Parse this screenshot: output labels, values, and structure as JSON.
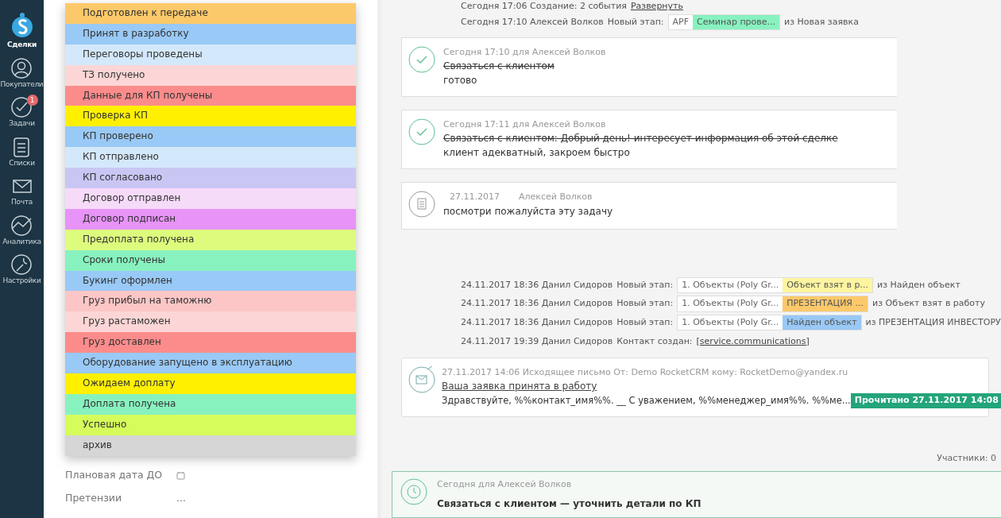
{
  "sidebar": {
    "brand": "Сделки",
    "items": [
      {
        "label": "Покупатели"
      },
      {
        "label": "Задачи",
        "badge": "1"
      },
      {
        "label": "Списки"
      },
      {
        "label": "Почта"
      },
      {
        "label": "Аналитика"
      },
      {
        "label": "Настройки"
      }
    ]
  },
  "stage_dropdown": {
    "items": [
      {
        "label": "Подготовлен к передаче",
        "color": "#fcc96a"
      },
      {
        "label": "Принят в разработку",
        "color": "#99c9f6"
      },
      {
        "label": "Переговоры проведены",
        "color": "#d4e8fb"
      },
      {
        "label": "ТЗ получено",
        "color": "#fcd6d6"
      },
      {
        "label": "Данные для КП получены",
        "color": "#fc8c8c"
      },
      {
        "label": "Проверка КП",
        "color": "#fff000"
      },
      {
        "label": "КП проверено",
        "color": "#99c9f6"
      },
      {
        "label": "КП отправлено",
        "color": "#d4e8fb"
      },
      {
        "label": "КП согласовано",
        "color": "#c9c6f4"
      },
      {
        "label": "Договор отправлен",
        "color": "#f6dbf9"
      },
      {
        "label": "Договор подписан",
        "color": "#e793f8"
      },
      {
        "label": "Предоплата получена",
        "color": "#ddfc7d"
      },
      {
        "label": "Сроки получены",
        "color": "#88f2bf"
      },
      {
        "label": "Букинг оформлен",
        "color": "#99c9f6"
      },
      {
        "label": "Груз прибыл на таможню",
        "color": "#fcc6c6"
      },
      {
        "label": "Груз растаможен",
        "color": "#fcd6d6"
      },
      {
        "label": "Груз доставлен",
        "color": "#fc8c8c"
      },
      {
        "label": "Оборудование запущено в эксплуатацию",
        "color": "#99c9f6"
      },
      {
        "label": "Ожидаем доплату",
        "color": "#fff000"
      },
      {
        "label": "Доплата получена",
        "color": "#88f2bf"
      },
      {
        "label": "Успешно",
        "color": "#d5fc5a"
      },
      {
        "label": "архив",
        "color": "#d6d6d6"
      }
    ]
  },
  "fields": [
    {
      "label": "Плановая дата ДО",
      "kind": "date"
    },
    {
      "label": "Претензии",
      "kind": "text",
      "value": "..."
    }
  ],
  "feed": [
    {
      "kind": "event",
      "text": "Сегодня 17:06 Создание: 2 события",
      "link": "Развернуть"
    },
    {
      "kind": "stage",
      "meta": "Сегодня 17:10 Алексей Волков",
      "label": "Новый этап:",
      "pipeline": "APF",
      "stage": "Семинар прове...",
      "color": "#88f2bf",
      "from": "из Новая заявка"
    },
    {
      "kind": "task",
      "meta": "Сегодня 17:10  для Алексей Волков",
      "title": "Связаться с клиентом",
      "done": true,
      "result": "готово"
    },
    {
      "kind": "task",
      "meta": "Сегодня 17:11  для Алексей Волков",
      "title": "Связаться с клиентом: Добрый день! интересует информация об этой сделке",
      "done": true,
      "result": "клиент адекватный, закроем быстро"
    },
    {
      "kind": "note",
      "date": "27.11.2017",
      "author": "Алексей Волков",
      "text": "посмотри пожалуйста эту задачу"
    },
    {
      "kind": "stage",
      "meta": "24.11.2017 18:36 Данил Сидоров",
      "label": "Новый этап:",
      "pipeline": "1. Объекты (Poly Gr...",
      "stage": "Объект взят в р...",
      "color": "#fdf5a0",
      "from": "из Найден объект"
    },
    {
      "kind": "stage",
      "meta": "24.11.2017 18:36 Данил Сидоров",
      "label": "Новый этап:",
      "pipeline": "1. Объекты (Poly Gr...",
      "stage": "ПРЕЗЕНТАЦИЯ ...",
      "color": "#fcc96a",
      "from": "из Объект взят в работу"
    },
    {
      "kind": "stage",
      "meta": "24.11.2017 18:36 Данил Сидоров",
      "label": "Новый этап:",
      "pipeline": "1. Объекты (Poly Gr...",
      "stage": "Найден объект",
      "color": "#99c9f6",
      "from": "из ПРЕЗЕНТАЦИЯ ИНВЕСТОРУ"
    },
    {
      "kind": "contact",
      "meta": "24.11.2017 19:39 Данил Сидоров",
      "label": "Контакт создан:",
      "link": "[service.communications]"
    },
    {
      "kind": "email",
      "meta": "27.11.2017 14:06 Исходящее письмо От: Demo RocketCRM кому: RocketDemo@yandex.ru",
      "subject": "Ваша заявка принята в работу",
      "body": "Здравствуйте, %%контакт_имя%%. __ С уважением, %%менеджер_имя%%. %%ме...",
      "status": "Прочитано 27.11.2017 14:08"
    }
  ],
  "participants": "Участники: 0",
  "reminder": {
    "meta": "Сегодня для Алексей Волков",
    "title": "Связаться с клиентом — уточнить детали по КП"
  }
}
